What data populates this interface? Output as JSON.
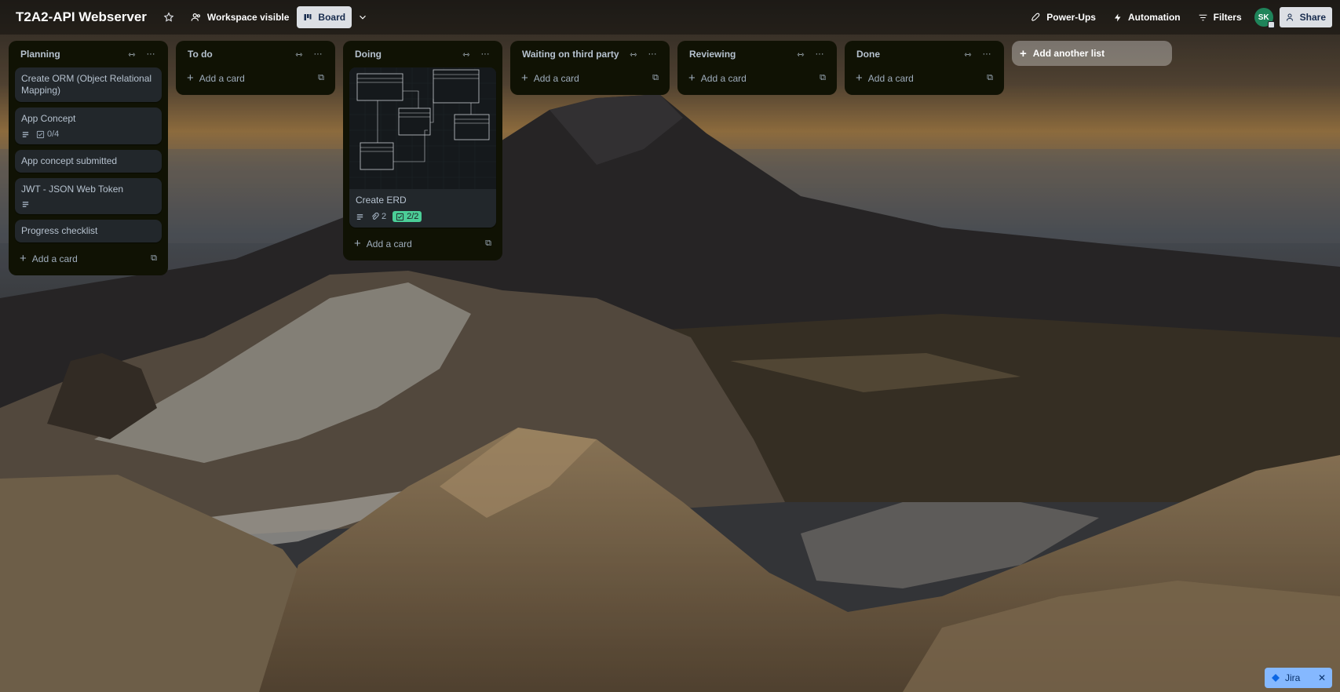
{
  "topbar": {
    "title": "T2A2-API Webserver",
    "visibility": "Workspace visible",
    "view": "Board",
    "power_ups": "Power-Ups",
    "automation": "Automation",
    "filters": "Filters",
    "avatar_initials": "SK",
    "share": "Share"
  },
  "lists": [
    {
      "title": "Planning",
      "cards": [
        {
          "title": "Create ORM (Object Relational Mapping)"
        },
        {
          "title": "App Concept",
          "has_description": true,
          "checklist": "0/4"
        },
        {
          "title": "App concept submitted"
        },
        {
          "title": "JWT - JSON Web Token",
          "has_description": true
        },
        {
          "title": "Progress checklist"
        }
      ],
      "add_card": "Add a card"
    },
    {
      "title": "To do",
      "cards": [],
      "add_card": "Add a card"
    },
    {
      "title": "Doing",
      "cards": [
        {
          "title": "Create ERD",
          "has_description": true,
          "attachments": "2",
          "checklist": "2/2",
          "cover": "erd-diagram-image"
        }
      ],
      "add_card": "Add a card"
    },
    {
      "title": "Waiting on third party",
      "cards": [],
      "add_card": "Add a card"
    },
    {
      "title": "Reviewing",
      "cards": [],
      "add_card": "Add a card"
    },
    {
      "title": "Done",
      "cards": [],
      "add_card": "Add a card"
    }
  ],
  "add_list": "Add another list",
  "jira": {
    "label": "Jira",
    "close": "✕"
  },
  "colors": {
    "list_bg": "#101204",
    "card_bg": "#22272b",
    "checklist_done": "#4bce97",
    "avatar": "#1f845a",
    "jira": "#85b8ff"
  },
  "background": "mountain-landscape-photo"
}
